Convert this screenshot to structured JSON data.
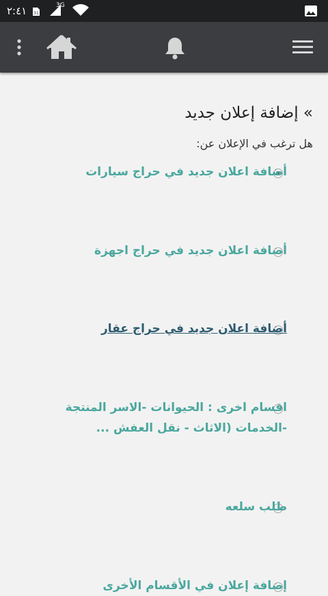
{
  "status_bar": {
    "time": "٢:٤١",
    "sim_label": "31",
    "network_label": "3G",
    "icons": [
      "sim-card-icon",
      "cellular-signal-icon",
      "wifi-icon",
      "image-notification-icon"
    ]
  },
  "app_bar": {
    "icons": [
      "more-vert-icon",
      "home-icon",
      "bell-icon",
      "hamburger-menu-icon"
    ],
    "background": "#3b3d40"
  },
  "page": {
    "title": "» إضافة إعلان جديد",
    "question": "هل ترغب في الإعلان عن:",
    "accent_color": "#4aa79e",
    "active_color": "#2d5b70"
  },
  "options": [
    {
      "label": "أضافة اعلان جديد في حراج سيارات",
      "checked": true
    },
    {
      "label": "أضافة اعلان جديد في حراج اجهزة",
      "checked": false
    },
    {
      "label": "أضافة اعلان جديد في حراج عقار",
      "checked": false,
      "highlighted": true
    },
    {
      "label": "اقسام اخرى : الحيوانات -الاسر المنتجة -الخدمات (الاثاث - نقل العفش ...",
      "checked": false
    },
    {
      "label": "طلب سلعه",
      "checked": false
    },
    {
      "label": "إضافة إعلان في الأقسام الأخرى",
      "checked": false
    }
  ]
}
